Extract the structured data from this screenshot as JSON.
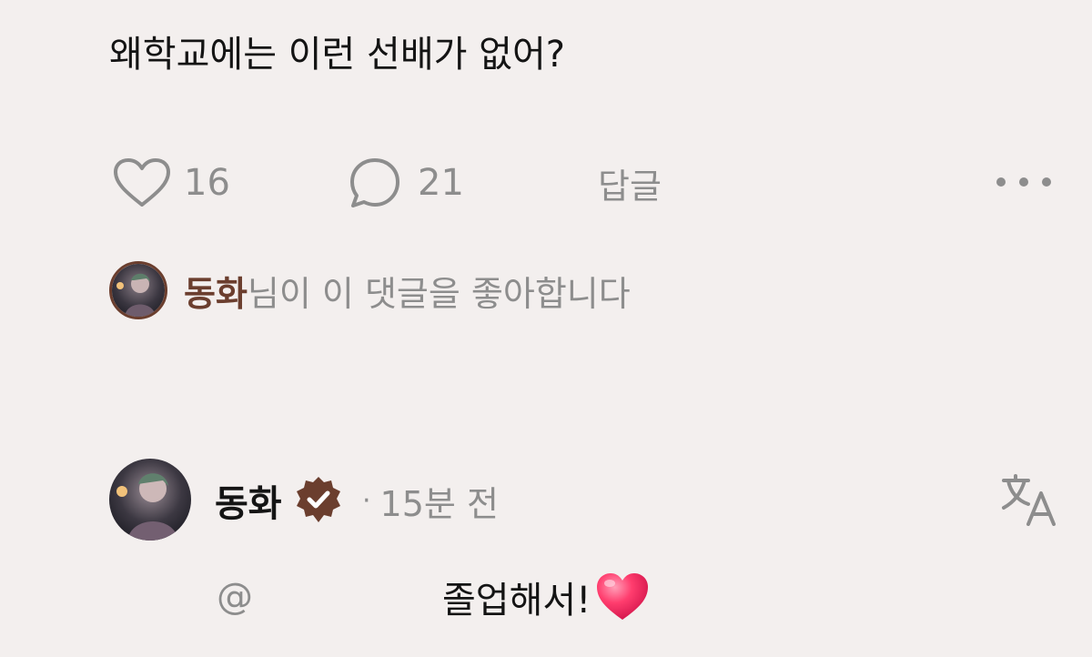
{
  "post": {
    "text": "왜학교에는 이런 선배가 없어?"
  },
  "actions": {
    "like_count": "16",
    "comment_count": "21",
    "reply_label": "답글"
  },
  "liked_by": {
    "name": "동화",
    "suffix": "님이 이 댓글을 좋아합니다"
  },
  "reply": {
    "author": "동화",
    "dot": "·",
    "time": "15분 전",
    "mention": "@",
    "text": "졸업해서!"
  },
  "colors": {
    "background": "#f3efee",
    "muted": "#8d8d8d",
    "verified_badge": "#6b3e2e",
    "heart_emoji": "#ff3d6e"
  },
  "icons": [
    "heart-icon",
    "comment-bubble-icon",
    "more-icon",
    "verified-badge-icon",
    "translate-icon",
    "red-heart-emoji"
  ]
}
